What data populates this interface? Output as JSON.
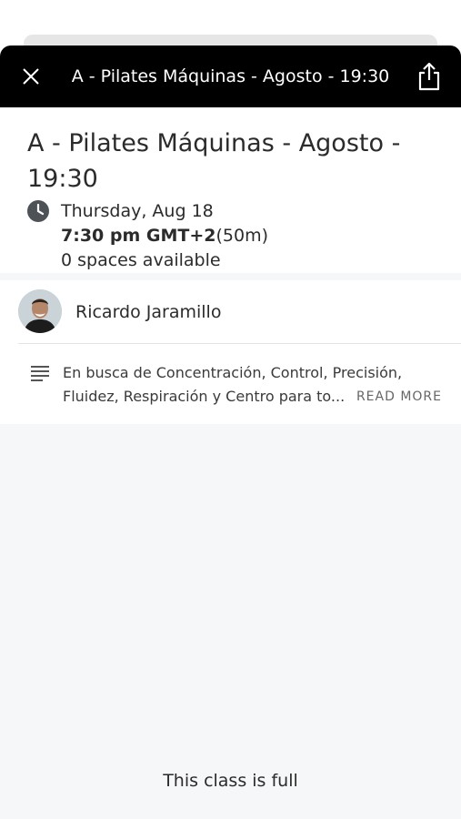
{
  "header": {
    "title": "A - Pilates Máquinas - Agosto - 19:30",
    "close_icon": "close-icon",
    "share_icon": "share-icon"
  },
  "class_info": {
    "title": "A - Pilates Máquinas - Agosto - 19:30",
    "date": "Thursday, Aug 18",
    "time": "7:30 pm GMT+2",
    "duration": "(50m)",
    "spaces": "0 spaces available"
  },
  "instructor": {
    "name": "Ricardo Jaramillo"
  },
  "description": {
    "text": "En busca de Concentración, Control, Precisión, Fluidez, Respiración y Centro para to...",
    "read_more": "READ MORE"
  },
  "footer": {
    "status": "This class is full"
  }
}
